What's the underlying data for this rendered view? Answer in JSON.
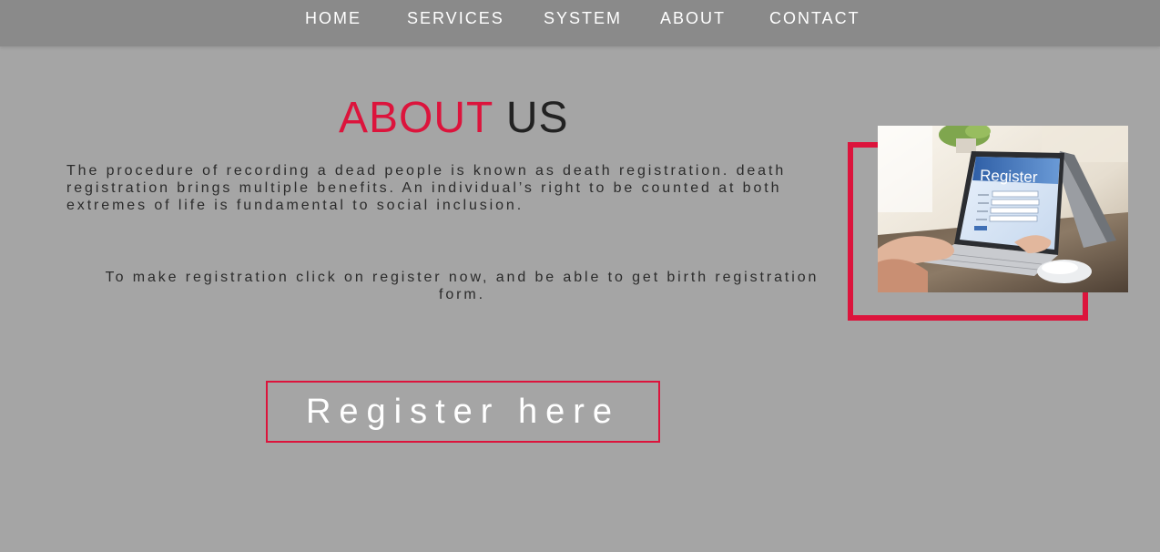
{
  "nav": {
    "items": [
      {
        "label": "HOME"
      },
      {
        "label": "SERVICES"
      },
      {
        "label": "SYSTEM"
      },
      {
        "label": "ABOUT"
      },
      {
        "label": "CONTACT"
      }
    ]
  },
  "about": {
    "heading_accent": "ABOUT",
    "heading_rest": "US",
    "paragraph1": "The procedure of recording a dead people is known as death registration. death registration brings multiple benefits. An individual’s right to be counted at both extremes of life is fundamental to social inclusion.",
    "paragraph2": "To make registration click on register now, and be able to get birth registration form.",
    "register_button": "Register here"
  },
  "image": {
    "screen_title": "Register",
    "icon": "laptop-register-photo"
  },
  "colors": {
    "page_background": "#a5a5a5",
    "navbar_background": "#8a8a8a",
    "accent": "#dc143c",
    "heading_text": "#222222",
    "body_text": "#2b2b2b",
    "nav_text": "#ffffff"
  }
}
